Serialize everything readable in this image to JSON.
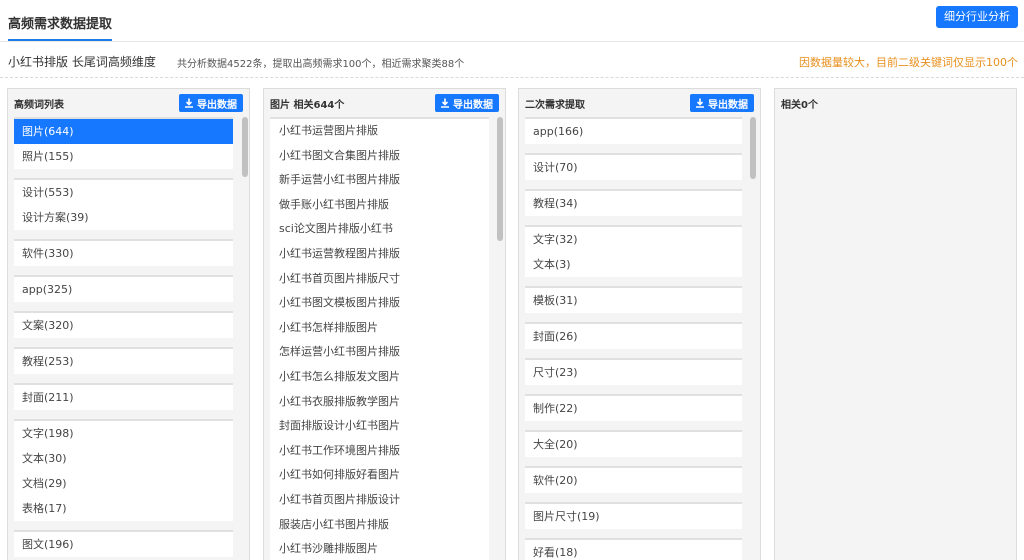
{
  "header": {
    "title": "高频需求数据提取",
    "analysis_button": "细分行业分析"
  },
  "subheader": {
    "keyword_title": "小红书排版 长尾词高频维度",
    "stats": "共分析数据4522条，提取出高频需求100个，相近需求聚类88个",
    "notice": "因数据量较大，目前二级关键词仅显示100个"
  },
  "export_label": "导出数据",
  "panel1": {
    "title": "高频词列表",
    "groups": [
      [
        "图片(644)",
        "照片(155)"
      ],
      [
        "设计(553)",
        "设计方案(39)"
      ],
      [
        "软件(330)"
      ],
      [
        "app(325)"
      ],
      [
        "文案(320)"
      ],
      [
        "教程(253)"
      ],
      [
        "封面(211)"
      ],
      [
        "文字(198)",
        "文本(30)",
        "文档(29)",
        "表格(17)"
      ],
      [
        "图文(196)"
      ]
    ]
  },
  "panel2": {
    "title": "图片 相关644个",
    "items": [
      "小红书运营图片排版",
      "小红书图文合集图片排版",
      "新手运营小红书图片排版",
      "做手账小红书图片排版",
      "sci论文图片排版小红书",
      "小红书运营教程图片排版",
      "小红书首页图片排版尺寸",
      "小红书图文模板图片排版",
      "小红书怎样排版图片",
      "怎样运营小红书图片排版",
      "小红书怎么排版发文图片",
      "小红书衣服排版教学图片",
      "封面排版设计小红书图片",
      "小红书工作环境图片排版",
      "小红书如何排版好看图片",
      "小红书首页图片排版设计",
      "服装店小红书图片排版",
      "小红书沙雕排版图片"
    ]
  },
  "panel3": {
    "title": "二次需求提取",
    "groups": [
      [
        "app(166)"
      ],
      [
        "设计(70)"
      ],
      [
        "教程(34)"
      ],
      [
        "文字(32)",
        "文本(3)"
      ],
      [
        "模板(31)"
      ],
      [
        "封面(26)"
      ],
      [
        "尺寸(23)"
      ],
      [
        "制作(22)"
      ],
      [
        "大全(20)"
      ],
      [
        "软件(20)"
      ],
      [
        "图片尺寸(19)"
      ],
      [
        "好看(18)"
      ]
    ]
  },
  "panel4": {
    "title": "相关0个"
  },
  "colors": {
    "accent": "#1677ff",
    "notice": "#e8901d"
  }
}
